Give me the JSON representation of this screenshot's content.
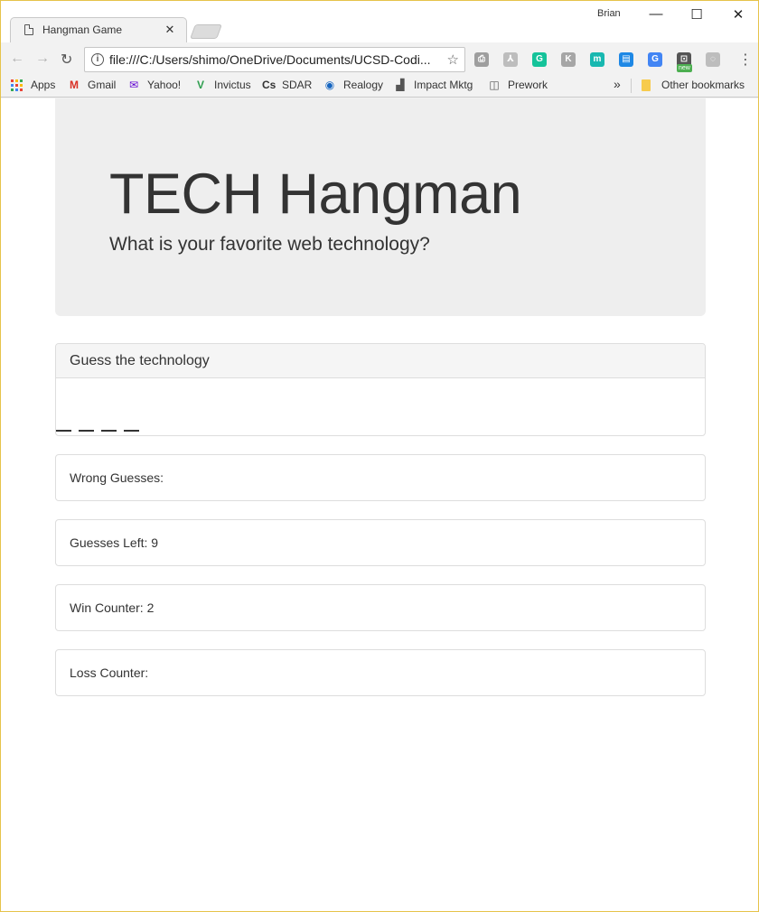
{
  "browser": {
    "tab_title": "Hangman Game",
    "tab_close": "✕",
    "profile_name": "Brian",
    "window_controls": {
      "minimize": "—",
      "maximize": "☐",
      "close": "✕"
    },
    "nav": {
      "back": "←",
      "forward": "→",
      "reload": "↻"
    },
    "url": "file:///C:/Users/shimo/OneDrive/Documents/UCSD-Codi...",
    "star": "☆",
    "extensions": [
      {
        "name": "print-icon",
        "color": "#9e9e9e",
        "glyph": "⎙"
      },
      {
        "name": "pdf-icon",
        "color": "#bdbdbd",
        "glyph": "⅄"
      },
      {
        "name": "grammarly-icon",
        "color": "#15c39a",
        "glyph": "G"
      },
      {
        "name": "extension-k-icon",
        "color": "#a6a6a6",
        "glyph": "K"
      },
      {
        "name": "extension-m-icon",
        "color": "#18b8b0",
        "glyph": "m"
      },
      {
        "name": "reader-icon",
        "color": "#1e88e5",
        "glyph": "▤"
      },
      {
        "name": "translate-icon",
        "color": "#4285f4",
        "glyph": "G"
      },
      {
        "name": "screenshot-icon",
        "color": "#555555",
        "glyph": "⊡"
      },
      {
        "name": "extension-circle-icon",
        "color": "#bdbdbd",
        "glyph": "◌"
      }
    ],
    "new_badge": "new",
    "menu": "⋮",
    "bookmarks": [
      {
        "label": "Apps",
        "icon": "apps-icon"
      },
      {
        "label": "Gmail",
        "icon": "gmail-icon",
        "glyph": "M",
        "color": "#d93025"
      },
      {
        "label": "Yahoo!",
        "icon": "yahoo-icon",
        "glyph": "✉",
        "color": "#5f01d1"
      },
      {
        "label": "Invictus",
        "icon": "invictus-icon",
        "glyph": "V",
        "color": "#2e9e4f"
      },
      {
        "label": "SDAR",
        "icon": "sdar-icon",
        "glyph": "Cs",
        "color": "#333333"
      },
      {
        "label": "Realogy",
        "icon": "realogy-icon",
        "glyph": "◉",
        "color": "#1565c0"
      },
      {
        "label": "Impact Mktg",
        "icon": "impact-icon",
        "glyph": "▟",
        "color": "#555555"
      },
      {
        "label": "Prework",
        "icon": "prework-icon",
        "glyph": "🕮",
        "color": "#555555"
      }
    ],
    "bookmarks_overflow": "»",
    "other_bookmarks": "Other bookmarks"
  },
  "jumbotron": {
    "title": "TECH Hangman",
    "subtitle": "What is your favorite web technology?"
  },
  "word_panel": {
    "heading": "Guess the technology",
    "blank_count": 4
  },
  "stats": {
    "wrong_guesses": "Wrong Guesses:",
    "guesses_left": "Guesses Left: 9",
    "win_counter": "Win Counter: 2",
    "loss_counter": "Loss Counter:"
  }
}
